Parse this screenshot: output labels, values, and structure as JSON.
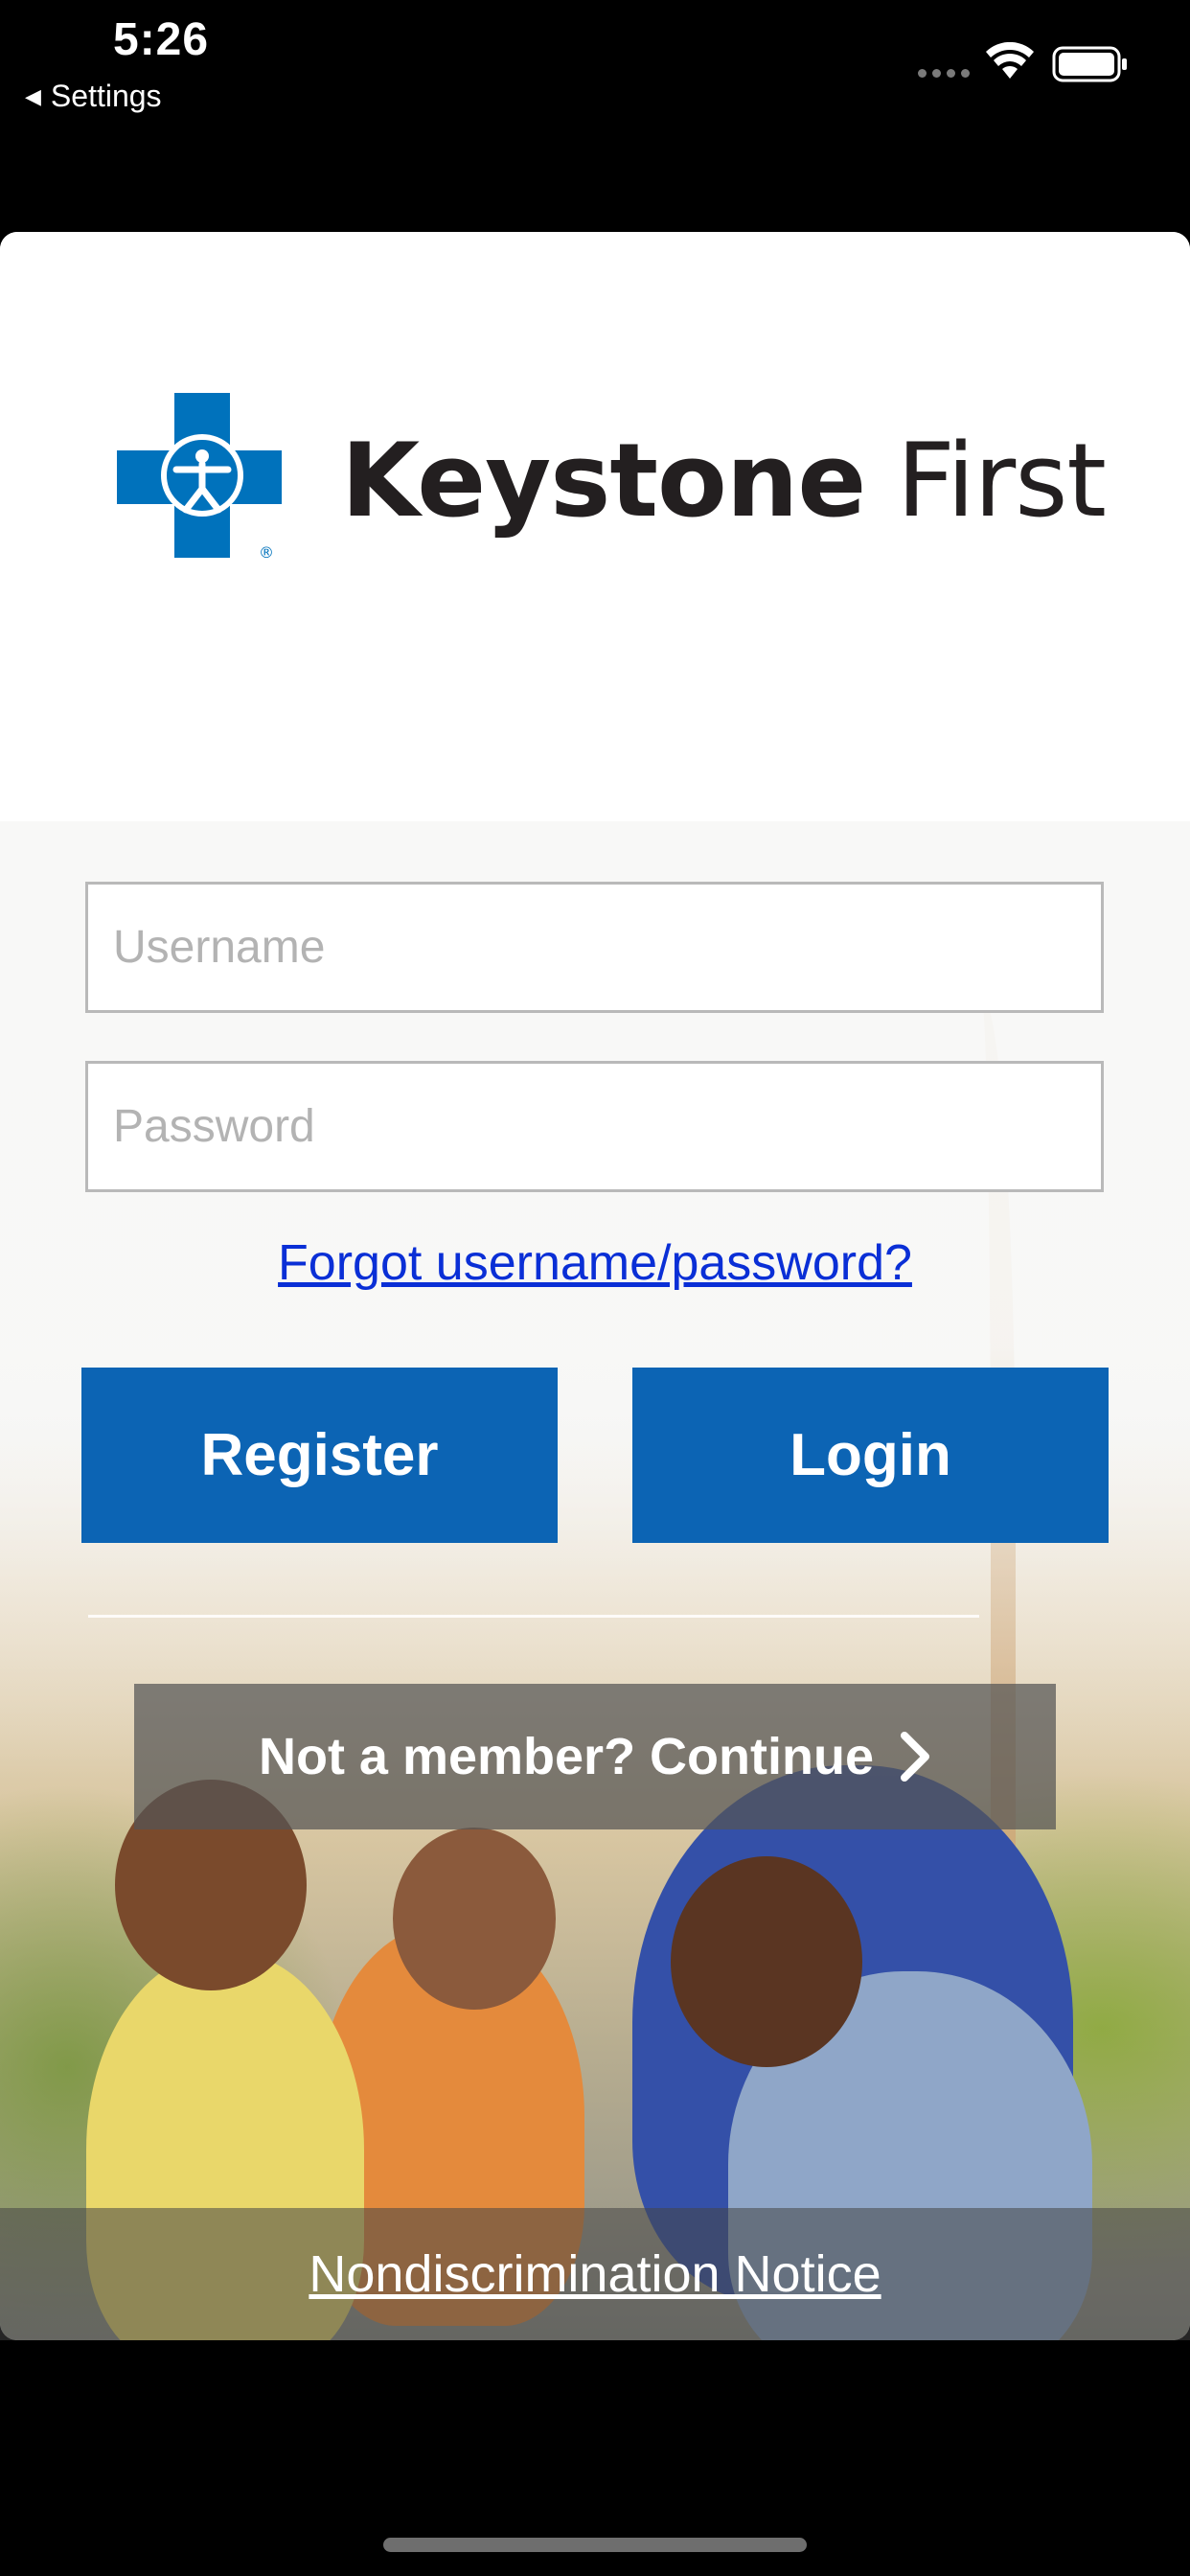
{
  "status_bar": {
    "time": "5:26",
    "back_label": "Settings",
    "back_arrow": "◀"
  },
  "brand": {
    "name_bold": "Keystone",
    "name_light": "First",
    "logo_icon": "blue-cross-logo-icon",
    "brand_color": "#0072bc"
  },
  "login_form": {
    "username_placeholder": "Username",
    "password_placeholder": "Password",
    "forgot_label": "Forgot username/password?",
    "register_label": "Register",
    "login_label": "Login",
    "button_color": "#0c64b4"
  },
  "guest": {
    "continue_label": "Not a member? Continue",
    "continue_icon": "chevron-right-icon"
  },
  "footer": {
    "notice_label": "Nondiscrimination Notice"
  },
  "icons": {
    "wifi": "wifi-icon",
    "battery": "battery-icon",
    "signal": "signal-dots-icon"
  }
}
